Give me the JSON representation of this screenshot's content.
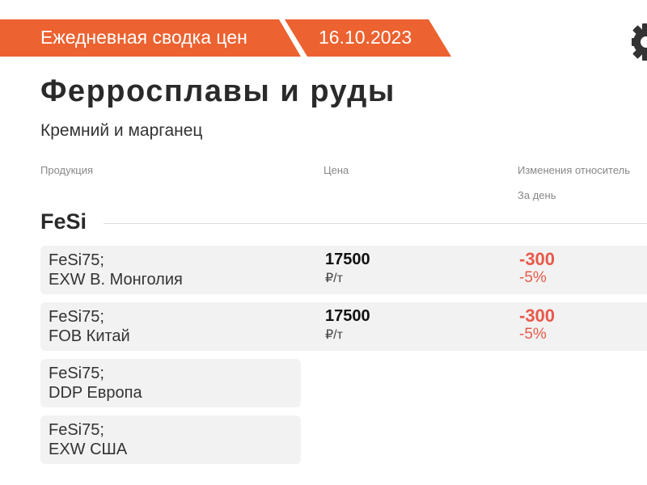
{
  "banner": {
    "title": "Ежедневная сводка цен",
    "date": "16.10.2023",
    "color": "#ec6230"
  },
  "page": {
    "title": "Ферросплавы и руды",
    "subtitle": "Кремний и марганец"
  },
  "columns": {
    "product": "Продукция",
    "price": "Цена",
    "change": "Изменения относитель",
    "change_sub": "За день"
  },
  "section": {
    "title": "FeSi",
    "rows": [
      {
        "product_line1": "FeSi75;",
        "product_line2": "EXW В. Монголия",
        "price": "17500",
        "unit": "₽/т",
        "change": "-300",
        "change_pct": "-5%"
      },
      {
        "product_line1": "FeSi75;",
        "product_line2": "FOB Китай",
        "price": "17500",
        "unit": "₽/т",
        "change": "-300",
        "change_pct": "-5%"
      },
      {
        "product_line1": "FeSi75;",
        "product_line2": "DDP Европа"
      },
      {
        "product_line1": "FeSi75;",
        "product_line2": "EXW США"
      }
    ]
  },
  "colors": {
    "negative": "#e8594a",
    "row_bg": "#f2f2f2"
  },
  "icons": {
    "settings": "gear-icon"
  }
}
